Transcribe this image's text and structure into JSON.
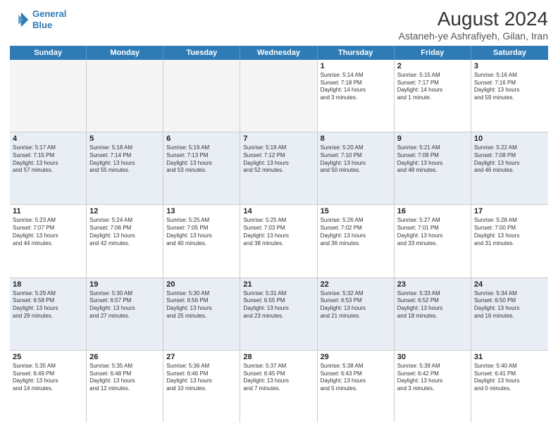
{
  "logo": {
    "line1": "General",
    "line2": "Blue"
  },
  "title": "August 2024",
  "subtitle": "Astaneh-ye Ashrafiyeh, Gilan, Iran",
  "days": [
    "Sunday",
    "Monday",
    "Tuesday",
    "Wednesday",
    "Thursday",
    "Friday",
    "Saturday"
  ],
  "weeks": [
    [
      {
        "day": "",
        "text": ""
      },
      {
        "day": "",
        "text": ""
      },
      {
        "day": "",
        "text": ""
      },
      {
        "day": "",
        "text": ""
      },
      {
        "day": "1",
        "text": "Sunrise: 5:14 AM\nSunset: 7:18 PM\nDaylight: 14 hours\nand 3 minutes."
      },
      {
        "day": "2",
        "text": "Sunrise: 5:15 AM\nSunset: 7:17 PM\nDaylight: 14 hours\nand 1 minute."
      },
      {
        "day": "3",
        "text": "Sunrise: 5:16 AM\nSunset: 7:16 PM\nDaylight: 13 hours\nand 59 minutes."
      }
    ],
    [
      {
        "day": "4",
        "text": "Sunrise: 5:17 AM\nSunset: 7:15 PM\nDaylight: 13 hours\nand 57 minutes."
      },
      {
        "day": "5",
        "text": "Sunrise: 5:18 AM\nSunset: 7:14 PM\nDaylight: 13 hours\nand 55 minutes."
      },
      {
        "day": "6",
        "text": "Sunrise: 5:19 AM\nSunset: 7:13 PM\nDaylight: 13 hours\nand 53 minutes."
      },
      {
        "day": "7",
        "text": "Sunrise: 5:19 AM\nSunset: 7:12 PM\nDaylight: 13 hours\nand 52 minutes."
      },
      {
        "day": "8",
        "text": "Sunrise: 5:20 AM\nSunset: 7:10 PM\nDaylight: 13 hours\nand 50 minutes."
      },
      {
        "day": "9",
        "text": "Sunrise: 5:21 AM\nSunset: 7:09 PM\nDaylight: 13 hours\nand 48 minutes."
      },
      {
        "day": "10",
        "text": "Sunrise: 5:22 AM\nSunset: 7:08 PM\nDaylight: 13 hours\nand 46 minutes."
      }
    ],
    [
      {
        "day": "11",
        "text": "Sunrise: 5:23 AM\nSunset: 7:07 PM\nDaylight: 13 hours\nand 44 minutes."
      },
      {
        "day": "12",
        "text": "Sunrise: 5:24 AM\nSunset: 7:06 PM\nDaylight: 13 hours\nand 42 minutes."
      },
      {
        "day": "13",
        "text": "Sunrise: 5:25 AM\nSunset: 7:05 PM\nDaylight: 13 hours\nand 40 minutes."
      },
      {
        "day": "14",
        "text": "Sunrise: 5:25 AM\nSunset: 7:03 PM\nDaylight: 13 hours\nand 38 minutes."
      },
      {
        "day": "15",
        "text": "Sunrise: 5:26 AM\nSunset: 7:02 PM\nDaylight: 13 hours\nand 36 minutes."
      },
      {
        "day": "16",
        "text": "Sunrise: 5:27 AM\nSunset: 7:01 PM\nDaylight: 13 hours\nand 33 minutes."
      },
      {
        "day": "17",
        "text": "Sunrise: 5:28 AM\nSunset: 7:00 PM\nDaylight: 13 hours\nand 31 minutes."
      }
    ],
    [
      {
        "day": "18",
        "text": "Sunrise: 5:29 AM\nSunset: 6:58 PM\nDaylight: 13 hours\nand 29 minutes."
      },
      {
        "day": "19",
        "text": "Sunrise: 5:30 AM\nSunset: 6:57 PM\nDaylight: 13 hours\nand 27 minutes."
      },
      {
        "day": "20",
        "text": "Sunrise: 5:30 AM\nSunset: 6:56 PM\nDaylight: 13 hours\nand 25 minutes."
      },
      {
        "day": "21",
        "text": "Sunrise: 5:31 AM\nSunset: 6:55 PM\nDaylight: 13 hours\nand 23 minutes."
      },
      {
        "day": "22",
        "text": "Sunrise: 5:32 AM\nSunset: 6:53 PM\nDaylight: 13 hours\nand 21 minutes."
      },
      {
        "day": "23",
        "text": "Sunrise: 5:33 AM\nSunset: 6:52 PM\nDaylight: 13 hours\nand 18 minutes."
      },
      {
        "day": "24",
        "text": "Sunrise: 5:34 AM\nSunset: 6:50 PM\nDaylight: 13 hours\nand 16 minutes."
      }
    ],
    [
      {
        "day": "25",
        "text": "Sunrise: 5:35 AM\nSunset: 6:49 PM\nDaylight: 13 hours\nand 14 minutes."
      },
      {
        "day": "26",
        "text": "Sunrise: 5:35 AM\nSunset: 6:48 PM\nDaylight: 13 hours\nand 12 minutes."
      },
      {
        "day": "27",
        "text": "Sunrise: 5:36 AM\nSunset: 6:46 PM\nDaylight: 13 hours\nand 10 minutes."
      },
      {
        "day": "28",
        "text": "Sunrise: 5:37 AM\nSunset: 6:45 PM\nDaylight: 13 hours\nand 7 minutes."
      },
      {
        "day": "29",
        "text": "Sunrise: 5:38 AM\nSunset: 6:43 PM\nDaylight: 13 hours\nand 5 minutes."
      },
      {
        "day": "30",
        "text": "Sunrise: 5:39 AM\nSunset: 6:42 PM\nDaylight: 13 hours\nand 3 minutes."
      },
      {
        "day": "31",
        "text": "Sunrise: 5:40 AM\nSunset: 6:41 PM\nDaylight: 13 hours\nand 0 minutes."
      }
    ]
  ]
}
